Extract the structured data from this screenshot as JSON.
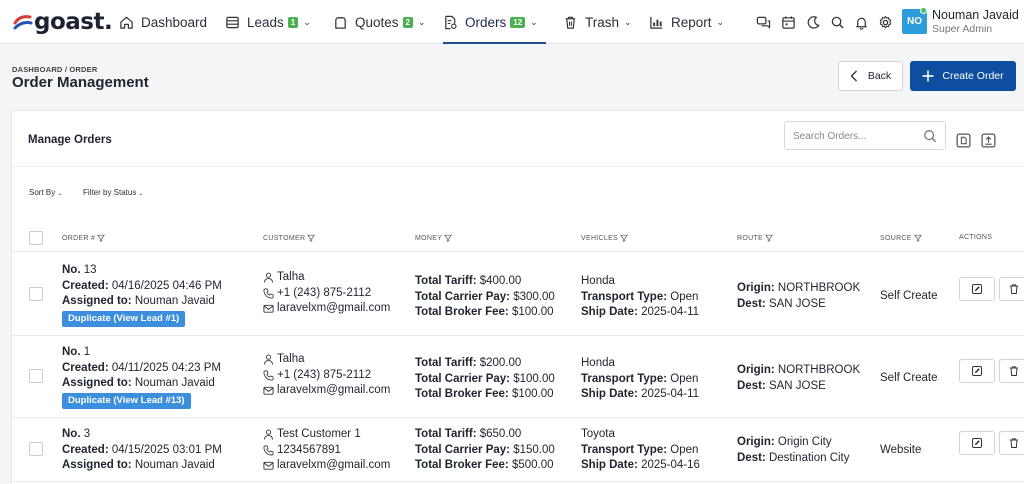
{
  "app": {
    "logo": "goast."
  },
  "nav": {
    "items": [
      {
        "label": "Dashboard",
        "icon": "home-icon"
      },
      {
        "label": "Leads",
        "badge": "1",
        "icon": "stack-icon"
      },
      {
        "label": "Quotes",
        "badge": "2",
        "icon": "clipboard-icon"
      },
      {
        "label": "Orders",
        "badge": "12",
        "icon": "document-settings-icon",
        "active": true
      },
      {
        "label": "Trash",
        "icon": "trash-icon"
      },
      {
        "label": "Report",
        "icon": "bar-chart-icon"
      }
    ],
    "right_icons": [
      "chat-icon",
      "calendar-icon",
      "moon-icon",
      "search-icon",
      "bell-icon",
      "gear-icon"
    ]
  },
  "user": {
    "initials": "NO",
    "name": "Nouman Javaid",
    "role": "Super Admin"
  },
  "page": {
    "breadcrumb": "DASHBOARD / ORDER",
    "title": "Order Management",
    "back_label": "Back",
    "create_label": "Create Order"
  },
  "card": {
    "title": "Manage Orders",
    "search_placeholder": "Search Orders...",
    "sort_label": "Sort By",
    "filter_label": "Filter by Status"
  },
  "table": {
    "headers": {
      "order": "ORDER #",
      "customer": "CUSTOMER",
      "money": "MONEY",
      "vehicles": "VEHICLES",
      "route": "ROUTE",
      "source": "SOURCE",
      "actions": "ACTIONS"
    },
    "labels": {
      "no": "No.",
      "created": "Created:",
      "assigned": "Assigned to:",
      "tariff": "Total Tariff:",
      "carrier": "Total Carrier Pay:",
      "broker": "Total Broker Fee:",
      "transport": "Transport Type:",
      "ship": "Ship Date:",
      "origin": "Origin:",
      "dest": "Dest:"
    },
    "rows": [
      {
        "number": "13",
        "created": "04/16/2025 04:46 PM",
        "assigned": "Nouman Javaid",
        "badge": "Duplicate (View Lead #1)",
        "customer_name": "Talha",
        "phone": "+1 (243) 875-2112",
        "email": "laravelxm@gmail.com",
        "tariff": "$400.00",
        "carrier": "$300.00",
        "broker": "$100.00",
        "make": "Honda",
        "transport": "Open",
        "ship": "2025-04-11",
        "origin": "NORTHBROOK",
        "dest": "SAN JOSE",
        "source": "Self Create"
      },
      {
        "number": "1",
        "created": "04/11/2025 04:23 PM",
        "assigned": "Nouman Javaid",
        "badge": "Duplicate (View Lead #13)",
        "customer_name": "Talha",
        "phone": "+1 (243) 875-2112",
        "email": "laravelxm@gmail.com",
        "tariff": "$200.00",
        "carrier": "$100.00",
        "broker": "$100.00",
        "make": "Honda",
        "transport": "Open",
        "ship": "2025-04-11",
        "origin": "NORTHBROOK",
        "dest": "SAN JOSE",
        "source": "Self Create"
      },
      {
        "number": "3",
        "created": "04/15/2025 03:01 PM",
        "assigned": "Nouman Javaid",
        "customer_name": "Test Customer 1",
        "phone": "1234567891",
        "email": "laravelxm@gmail.com",
        "tariff": "$650.00",
        "carrier": "$150.00",
        "broker": "$500.00",
        "make": "Toyota",
        "transport": "Open",
        "ship": "2025-04-16",
        "origin": "Origin City",
        "dest": "Destination City",
        "source": "Website"
      }
    ]
  },
  "colors": {
    "primary": "#0d4ea1",
    "badge_blue": "#3c8fdc",
    "nav_badge": "#4caf50"
  }
}
